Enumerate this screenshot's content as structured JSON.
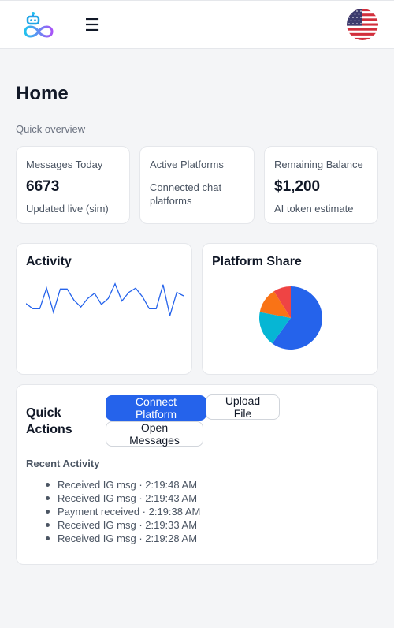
{
  "header": {
    "logo_icon": "robot-infinity-logo-icon",
    "menu_icon": "☰",
    "language_icon": "us-flag-icon"
  },
  "page": {
    "title": "Home",
    "subtitle": "Quick overview"
  },
  "stats": [
    {
      "label": "Messages Today",
      "value": "6673",
      "note": "Updated live (sim)"
    },
    {
      "label": "Active Platforms",
      "value": "",
      "note": "Connected chat platforms"
    },
    {
      "label": "Remaining Balance",
      "value": "$1,200",
      "note": "AI token estimate"
    }
  ],
  "activity": {
    "title": "Activity",
    "color": "#2563eb",
    "values": [
      44,
      38,
      38,
      62,
      34,
      61,
      61,
      48,
      40,
      50,
      56,
      43,
      50,
      67,
      47,
      57,
      62,
      52,
      38,
      38,
      66,
      30,
      57,
      53
    ]
  },
  "platform_share": {
    "title": "Platform Share",
    "slices": [
      {
        "value": 0.6,
        "color": "#2563eb"
      },
      {
        "value": 0.18,
        "color": "#06b6d4"
      },
      {
        "value": 0.13,
        "color": "#f97316"
      },
      {
        "value": 0.09,
        "color": "#ef4444"
      }
    ]
  },
  "quick_actions": {
    "title": "Quick Actions",
    "connect_label": "Connect Platform",
    "upload_label": "Upload File",
    "messages_label": "Open Messages"
  },
  "recent": {
    "title": "Recent Activity",
    "items": [
      "Received IG msg · 2:19:48 AM",
      "Received IG msg · 2:19:43 AM",
      "Payment received · 2:19:38 AM",
      "Received IG msg · 2:19:33 AM",
      "Received IG msg · 2:19:28 AM"
    ]
  },
  "colors": {
    "accent": "#2563eb",
    "background": "#f4f5f7",
    "card": "#ffffff"
  }
}
